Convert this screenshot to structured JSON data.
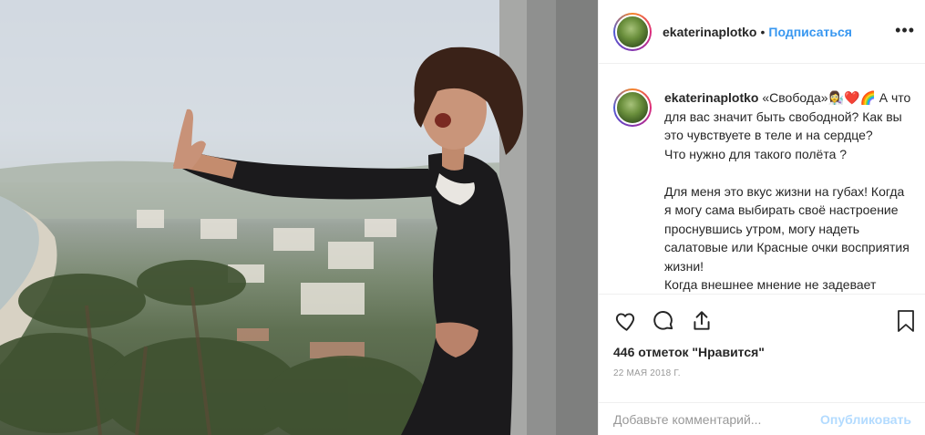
{
  "post": {
    "image_alt": "",
    "author": {
      "username": "ekaterinaplotko",
      "separator": "•",
      "follow_label": "Подписаться",
      "more_icon": "more-horizontal-icon"
    },
    "caption": {
      "username": "ekaterinaplotko",
      "text": "«Свобода»👩‍🔬❤️🌈 А что для вас значит быть свободной? Как вы это чувствуете в теле и на сердце?\nЧто нужно для такого полёта ?\n\nДля меня это вкус жизни на губах! Когда я могу сама выбирать своё настроение проснувшись утром, могу надеть салатовые или Красные очки восприятия жизни!\nКогда внешнее мнение не задевает"
    },
    "actions": {
      "like_icon": "heart-icon",
      "comment_icon": "comment-icon",
      "share_icon": "share-icon",
      "save_icon": "bookmark-icon"
    },
    "likes_text": "446 отметок \"Нравится\"",
    "date": "22 МАЯ 2018 Г.",
    "comment_box": {
      "placeholder": "Добавьте комментарий...",
      "publish_label": "Опубликовать"
    }
  }
}
